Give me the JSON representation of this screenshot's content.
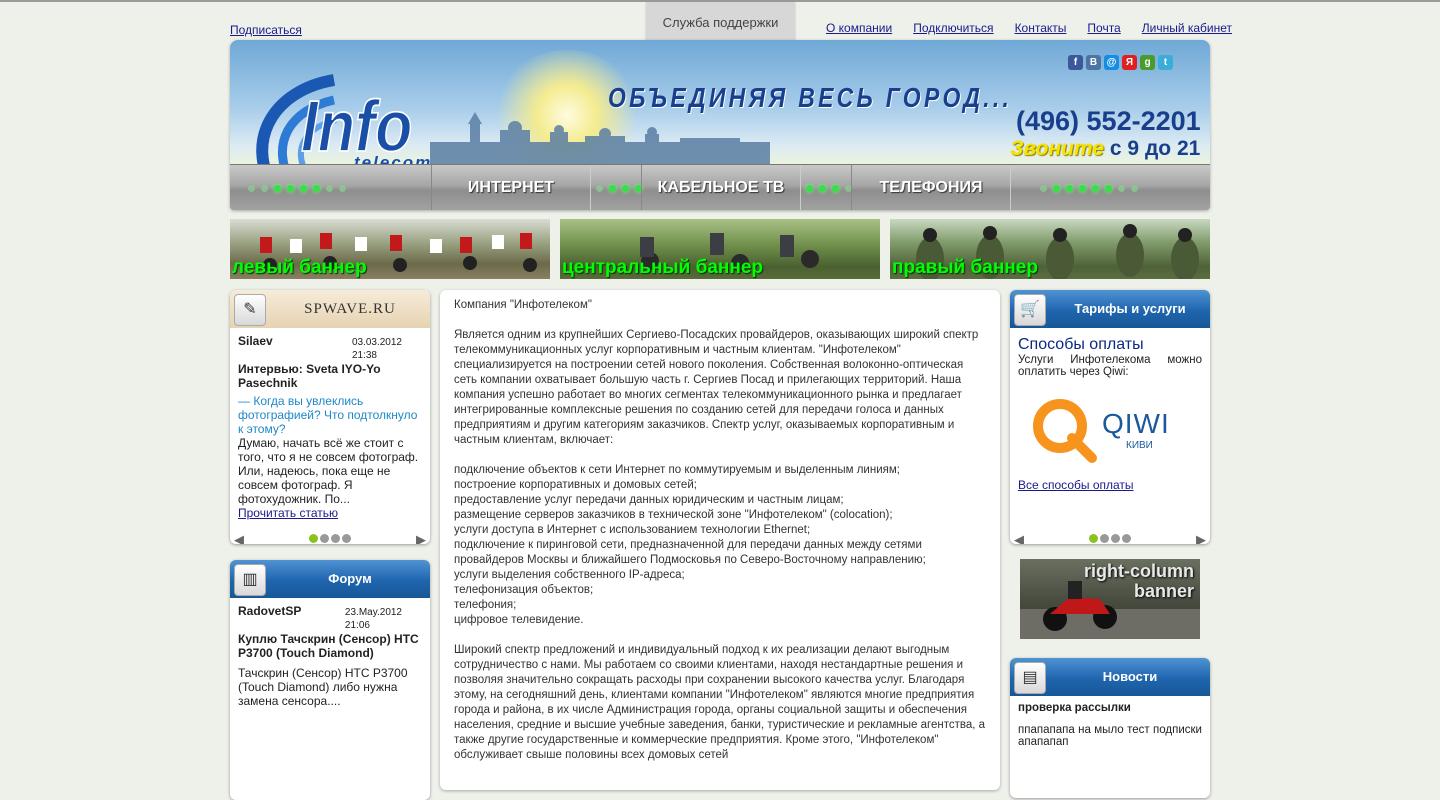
{
  "top": {
    "subscribe": "Подписаться",
    "support": "Служба поддержки",
    "nav": [
      "О компании",
      "Подключиться",
      "Контакты",
      "Почта",
      "Личный кабинет"
    ]
  },
  "header": {
    "logo_main": "Info",
    "logo_sub": "telecom",
    "slogan": "ОБЪЕДИНЯЯ ВЕСЬ ГОРОД...",
    "phone": "(496) 552-2201",
    "call_word": "Звоните",
    "call_hours": "с 9 до 21",
    "socials": [
      {
        "icon": "facebook-icon",
        "glyph": "f",
        "color": "#3b5998"
      },
      {
        "icon": "vkontakte-icon",
        "glyph": "В",
        "color": "#4c75a3"
      },
      {
        "icon": "mailru-icon",
        "glyph": "@",
        "color": "#168de2"
      },
      {
        "icon": "yandex-icon",
        "glyph": "Я",
        "color": "#e02020"
      },
      {
        "icon": "google-icon",
        "glyph": "g",
        "color": "#4a9b2e"
      },
      {
        "icon": "twitter-icon",
        "glyph": "t",
        "color": "#3aaed8"
      }
    ],
    "menu": [
      "ИНТЕРНЕТ",
      "КАБЕЛЬНОЕ ТВ",
      "ТЕЛЕФОНИЯ"
    ]
  },
  "banners": [
    "левый баннер",
    "центральный баннер",
    "правый баннер"
  ],
  "left": {
    "spwave": {
      "title": "SPWAVE.RU",
      "author": "Silaev",
      "date": "03.03.2012",
      "time": "21:38",
      "headline": "Интервью: Sveta IYO-Yo Pasechnik",
      "question": "— Когда вы увлеклись фотографией? Что подтолкнуло к этому?",
      "excerpt": "Думаю, начать всё же стоит с того, что я не совсем фотограф. Или, надеюсь, пока еще не совсем фотограф. Я фотохудожник. По...",
      "read_more": "Прочитать статью"
    },
    "forum": {
      "title": "Форум",
      "author": "RadovetSP",
      "date": "23.May.2012",
      "time": "21:06",
      "headline": "Куплю Тачскрин (Сенсор) HTC P3700 (Touch Diamond)",
      "excerpt": "Тачскрин (Сенсор) HTC P3700 (Touch Diamond) либо нужна замена сенсора...."
    }
  },
  "content": {
    "title": "Компания \"Инфотелеком\"",
    "intro": "Является одним из крупнейших Сергиево-Посадских провайдеров, оказывающих широкий спектр телекоммуникационных услуг корпоративным и частным клиентам. \"Инфотелеком\" специализируется на построении сетей нового поколения. Собственная волоконно-оптическая сеть компании охватывает большую часть г. Сергиев Посад и прилегающих территорий. Наша компания успешно работает во многих сегментах телекоммуникационного рынка и предлагает интегрированные комплексные решения по созданию сетей для передачи голоса и данных предприятиям и другим категориям заказчиков. Спектр услуг, оказываемых корпоративным и частным клиентам, включает:",
    "services": [
      "подключение объектов к сети Интернет по коммутируемым и выделенным линиям;",
      "построение корпоративных и домовых сетей;",
      "предоставление услуг передачи данных юридическим и частным лицам;",
      "размещение серверов заказчиков в технической зоне \"Инфотелеком\" (colocation);",
      "услуги доступа в Интернет с использованием технологии Ethernet;",
      "подключение к пиринговой сети, предназначенной для передачи данных между сетями провайдеров Москвы и ближайшего Подмосковья по Северо-Восточному направлению;",
      "услуги выделения собственного IP-адреса;",
      "телефонизация объектов;",
      "телефония;",
      "цифровое телевидение."
    ],
    "outro": "Широкий спектр предложений и индивидуальный подход к их реализации делают выгодным сотрудничество с нами. Мы работаем со своими клиентами, находя нестандартные решения и позволяя значительно сокращать расходы при сохранении высокого качества услуг. Благодаря этому, на сегодняшний день, клиентами компании \"Инфотелеком\" являются многие предприятия города и района, в их числе Администрация города, органы социальной защиты и обеспечения населения, средние и высшие учебные заведения, банки, туристические и рекламные агентства, а также другие государственные и коммерческие предприятия. Кроме этого, \"Инфотелеком\" обслуживает свыше половины всех домовых сетей"
  },
  "right": {
    "tariffs": {
      "title": "Тарифы и услуги",
      "heading": "Способы оплаты",
      "text": "Услуги Инфотелекома можно оплатить через Qiwi:",
      "qiwi": "QIWI",
      "qiwi_sub": "КИВИ",
      "link": "Все способы оплаты"
    },
    "banner": "right-column banner",
    "news": {
      "title": "Новости",
      "headline": "проверка рассылки",
      "text": "ппапапапа на мыло тест подписки апапапап"
    }
  },
  "colors": {
    "accent": "#1f65ae",
    "link": "#1a1a8c",
    "banner_text": "#00ff00",
    "pager_active": "#8cc21e"
  }
}
